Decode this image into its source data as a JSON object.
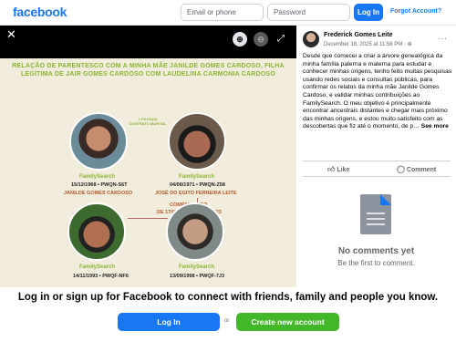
{
  "header": {
    "logo": "facebook",
    "email_placeholder": "Email or phone",
    "password_placeholder": "Password",
    "login_label": "Log In",
    "forgot_label": "Forgot Account?"
  },
  "viewer": {
    "close_glyph": "✕",
    "zoom_in_glyph": "⊕",
    "zoom_out_glyph": "⊖",
    "expand_glyph": "⤢",
    "photo": {
      "title": "RELAÇÃO DE PARENTESCO COM A MINHA MÃE JANILDE GOMES CARDOSO, FILHA LEGÍTIMA DE JAIR GOMES CARDOSO COM LAUDELINA CARMONIA CARDOSO",
      "brand": "FamilySearch",
      "contract_label": "1 FILHO(S) CONTRATO MARITAL",
      "people": [
        {
          "dob": "15/12/1968 • PWQN-S6T",
          "name": "JANILDE GOMES CARDOSO"
        },
        {
          "dob": "04/06/1971 • PWQN-Z58",
          "name": "JOSÉ DO EGITO FERREIRA LEITE"
        },
        {
          "dob": "14/11/1993 • PWQF-NF6",
          "name": ""
        },
        {
          "dob": "13/09/1998 • PWQF-7J3",
          "name": ""
        }
      ],
      "relation_label": "COMPANHEIRO",
      "relation_dates": "DE 17/02/1993 A 01/04/2023"
    }
  },
  "post": {
    "author": "Frederick Gomes Leite",
    "date": "December 18, 2025 at 11:58 PM · ",
    "more_glyph": "···",
    "caption": "Desde que comecei a criar a árvore genealógica da minha família paterna e materna para estudar e conhecer minhas origens, tenho feito muitas pesquisas usando redes sociais e consultas públicas, para confirmar os relatos da minha mãe Janilde Gomes Cardoso, e validar minhas contribuições ao FamilySearch. O meu objetivo é principalmente encontrar ancestrais distantes e chegar mais próximo das minhas origens, e estou muito satisfeito com as descobertas que fiz até o momento, de p…",
    "see_more": "See more",
    "like_label": "Like",
    "comment_label": "Comment",
    "no_comments": "No comments yet",
    "be_first": "Be the first to comment."
  },
  "banner": {
    "text": "Log in or sign up for Facebook to connect with friends, family and people you know.",
    "login_label": "Log In",
    "or_label": "or",
    "create_label": "Create new account"
  },
  "colors": {
    "brand_blue": "#1877f2",
    "create_green": "#42b72a",
    "familysearch_green": "#8ab634"
  }
}
